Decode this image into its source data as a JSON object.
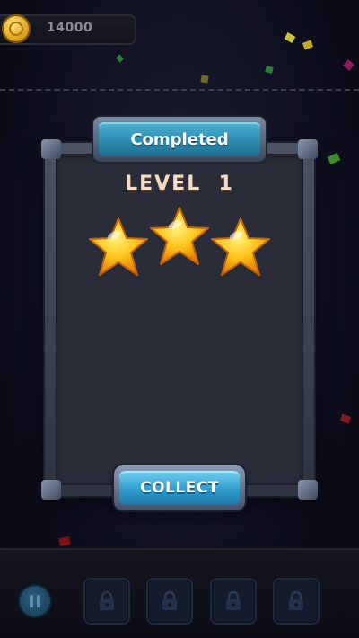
{
  "header": {
    "coins": "14000",
    "coin_icon": "gold-coin-icon"
  },
  "dialog": {
    "title": "Completed",
    "level_label": "LEVEL",
    "level_number": "1",
    "stars_earned": 3,
    "stars_total": 3,
    "collect_label": "COLLECT"
  },
  "bottom_bar": {
    "pause_icon": "pause-icon",
    "locked_slots": [
      {
        "icon": "lock-icon"
      },
      {
        "icon": "lock-icon"
      },
      {
        "icon": "lock-icon"
      },
      {
        "icon": "lock-icon"
      }
    ]
  },
  "colors": {
    "accent_blue": "#2f9ccb",
    "star_gold": "#ffc21a",
    "panel_bg": "#2a2d38"
  }
}
